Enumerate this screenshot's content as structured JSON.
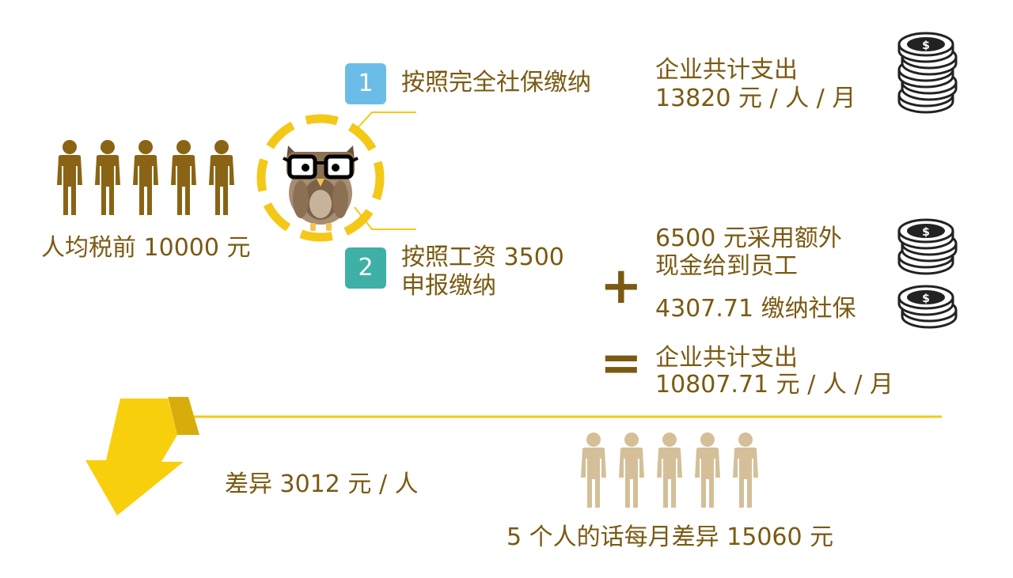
{
  "colors": {
    "text": "#7a5a12",
    "person_dark": "#8a6414",
    "person_light": "#d4bf98",
    "yellow": "#f4c817",
    "arrow_yellow": "#f8cf0c",
    "badge1": "#6bbde8",
    "badge2": "#3fb0a6"
  },
  "icons": {
    "people": "person-icon",
    "owl": "owl-glasses-icon",
    "coins": "coin-stack-icon",
    "arrow": "down-arrow-icon"
  },
  "left": {
    "group_size": 5,
    "label": "人均税前 10000 元"
  },
  "option1": {
    "num": "1",
    "label": "按照完全社保缴纳",
    "result_line1": "企业共计支出",
    "result_line2": "13820 元 / 人 / 月"
  },
  "option2": {
    "num": "2",
    "label_line1": "按照工资 3500",
    "label_line2": "申报缴纳",
    "item1_line1": "6500 元采用额外",
    "item1_line2": "现金给到员工",
    "item2": "4307.71 缴纳社保",
    "plus": "+",
    "equals": "=",
    "result_line1": "企业共计支出",
    "result_line2": "10807.71 元 / 人 / 月"
  },
  "summary": {
    "diff": "差异 3012 元 / 人",
    "group_size": 5,
    "total": "5 个人的话每月差异 15060 元"
  }
}
